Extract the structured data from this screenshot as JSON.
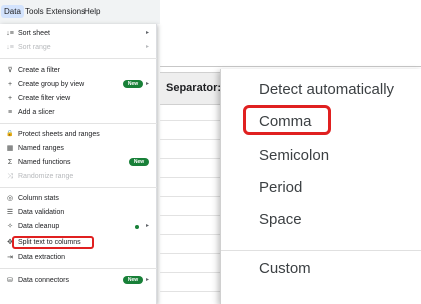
{
  "menubar": {
    "items": [
      {
        "label": "Data",
        "active": true
      },
      {
        "label": "Tools"
      },
      {
        "label": "Extensions"
      },
      {
        "label": "Help"
      }
    ]
  },
  "data_menu": {
    "items": [
      {
        "icon": "sort-icon",
        "glyph": "↓≡",
        "label": "Sort sheet",
        "submenu": true
      },
      {
        "icon": "sort-icon",
        "glyph": "↓≡",
        "label": "Sort range",
        "disabled": true,
        "submenu": true
      },
      {
        "icon": "filter-icon",
        "glyph": "⊽",
        "label": "Create a filter"
      },
      {
        "icon": "plus-icon",
        "glyph": "+",
        "label": "Create group by view",
        "badge": "New",
        "submenu": true
      },
      {
        "icon": "plus-icon",
        "glyph": "+",
        "label": "Create filter view"
      },
      {
        "icon": "slicer-icon",
        "glyph": "≡",
        "label": "Add a slicer"
      },
      {
        "icon": "lock-icon",
        "glyph": "🔒",
        "label": "Protect sheets and ranges"
      },
      {
        "icon": "named-ranges-icon",
        "glyph": "▦",
        "label": "Named ranges"
      },
      {
        "icon": "sigma-icon",
        "glyph": "Σ",
        "label": "Named functions",
        "badge": "New"
      },
      {
        "icon": "shuffle-icon",
        "glyph": "⤨",
        "label": "Randomize range",
        "disabled": true
      },
      {
        "icon": "column-stats-icon",
        "glyph": "◎",
        "label": "Column stats"
      },
      {
        "icon": "validation-icon",
        "glyph": "☰",
        "label": "Data validation"
      },
      {
        "icon": "cleanup-icon",
        "glyph": "✧",
        "label": "Data cleanup",
        "dot": true,
        "submenu": true
      },
      {
        "icon": "split-icon",
        "glyph": "✥",
        "label": "Split text to columns"
      },
      {
        "icon": "extraction-icon",
        "glyph": "⇥",
        "label": "Data extraction"
      },
      {
        "icon": "database-icon",
        "glyph": "⛁",
        "label": "Data connectors",
        "badge": "New",
        "submenu": true
      }
    ],
    "submenu_glyph": "▸"
  },
  "separator": {
    "label": "Separator:",
    "options": [
      "Detect automatically",
      "Comma",
      "Semicolon",
      "Period",
      "Space",
      "Custom"
    ],
    "highlighted": "Comma"
  },
  "colors": {
    "highlight": "#e02020",
    "badge": "#188038",
    "menubar_active": "#d3e3fd"
  }
}
